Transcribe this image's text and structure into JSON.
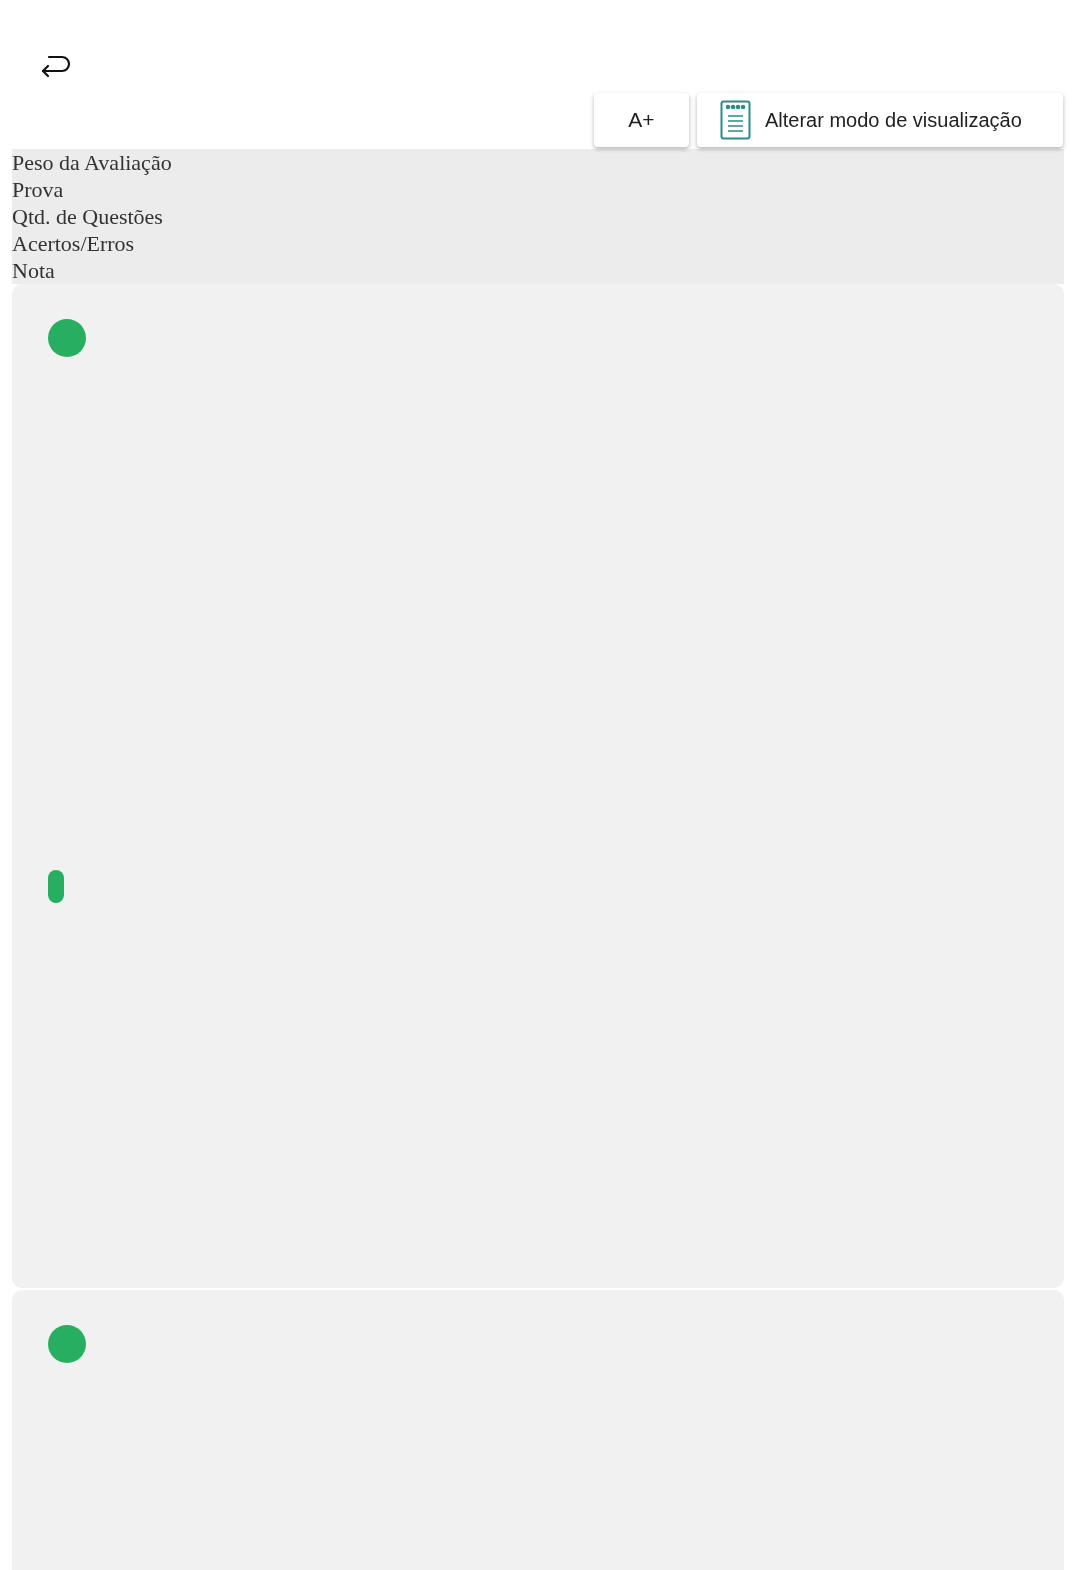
{
  "toolbar": {
    "font_button": "A+",
    "view_button": "Alterar modo de visualização"
  },
  "header_labels": [
    "Peso da Avaliação",
    "Prova",
    "Qtd. de Questões",
    "Acertos/Erros",
    "Nota"
  ],
  "cards": [
    {
      "markers": [
        {
          "kind": "circle"
        },
        {
          "kind": "oval"
        }
      ]
    },
    {
      "markers": [
        {
          "kind": "circle"
        }
      ]
    }
  ]
}
